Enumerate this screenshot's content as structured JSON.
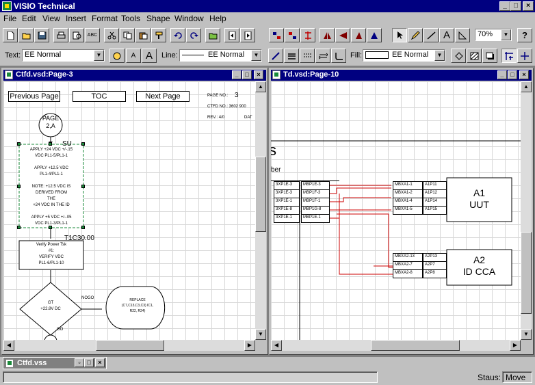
{
  "app": {
    "title": "VISIO Technical"
  },
  "menu": [
    "File",
    "Edit",
    "View",
    "Insert",
    "Format",
    "Tools",
    "Shape",
    "Window",
    "Help"
  ],
  "format_bar": {
    "text_label": "Text:",
    "text_style": "EE Normal",
    "line_label": "Line:",
    "line_style": "EE Normal",
    "fill_label": "Fill:",
    "fill_style": "EE Normal"
  },
  "toolbar": {
    "zoom": "70%"
  },
  "left_window": {
    "title": "Ctfd.vsd:Page-3",
    "nav": {
      "prev": "Previous Page",
      "toc": "TOC",
      "next": "Next Page"
    },
    "page_no_label": "PAGE NO.:",
    "page_no": "3",
    "ctfd_no": "CTFD NO.: 3602 900",
    "rev": "REV.: 4/0",
    "dat": "DAT",
    "connector": {
      "line1": "PAGE",
      "line2": "2,A"
    },
    "su_label": "SU",
    "block1": [
      "APPLY +24 VDC +/-.15",
      "VDC PL1-5/PL1-1",
      "",
      "APPLY +12.5 VDC",
      "PL1-4/PL1-1",
      "",
      "NOTE: +12.5 VDC IS",
      "DERIVED FROM",
      "THE",
      "+24 VDC IN THE ID",
      "",
      "APPLY +5 VDC +/-.05",
      "VDC PL1-3/PL1-1"
    ],
    "t_label": "T1C30.00",
    "block2": [
      "Verify Power Tsk",
      "#1:",
      "VERIFY VDC",
      "PL1-6/PL1-10"
    ],
    "decision": {
      "line1": "GT",
      "line2": "+22.8V DC"
    },
    "nogo": "NOGO",
    "go": "GO",
    "replace": {
      "line1": "REPLACE",
      "line2": "(C7,C13,C3,C3) IC1,",
      "line3": "R22, R24)"
    }
  },
  "right_window": {
    "title": "Td.vsd:Page-10",
    "frag_s": "s",
    "frag_ber": "ber",
    "left_col1": [
      "3XP1E-3",
      "3XP1E-3",
      "3XP1E-1",
      "3XP1E-8",
      "3XP1E-1"
    ],
    "left_col2": [
      "MBP1E-3",
      "MBP1F-3",
      "MBP1F-1",
      "MBP1G-8",
      "MBP1E-1"
    ],
    "a1": {
      "line1": "A1",
      "line2": "UUT"
    },
    "a1_pins1": [
      "MBXA1-1",
      "MBXA1-2",
      "MBXA1-4",
      "MBXA1-5"
    ],
    "a1_pins2": [
      "A1P11",
      "A1P12",
      "A1P14",
      "A1P15"
    ],
    "a2": {
      "line1": "A2",
      "line2": "ID CCA"
    },
    "a2_pins1": [
      "MBXA2-13",
      "MBXA2-7",
      "MBXA2-8"
    ],
    "a2_pins2": [
      "A2P13",
      "A2P7",
      "A2P8"
    ]
  },
  "stencil": {
    "title": "Ctfd.vss"
  },
  "status": {
    "label": "Staus:",
    "value": "Move"
  },
  "colors": {
    "titlebar": "#000080",
    "wire": "#cc0000",
    "handles": "#1a8a3a"
  }
}
